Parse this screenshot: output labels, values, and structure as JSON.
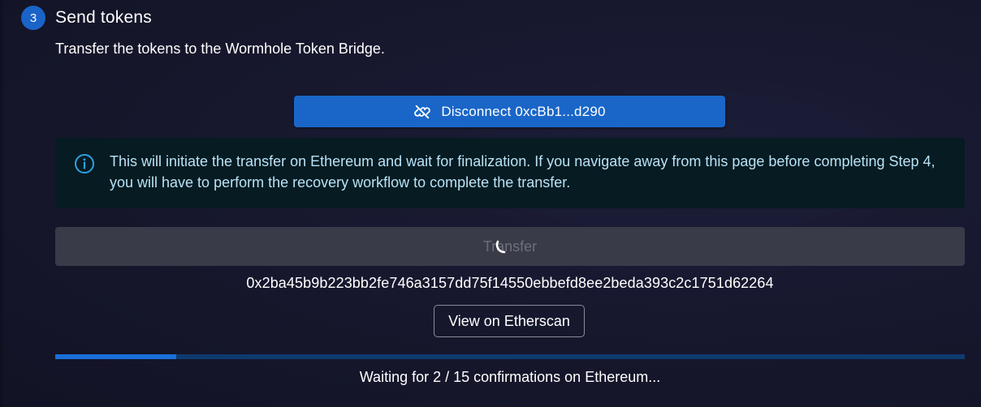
{
  "step": {
    "number": "3",
    "title": "Send tokens",
    "description": "Transfer the tokens to the Wormhole Token Bridge."
  },
  "wallet": {
    "disconnect_label": "Disconnect 0xcBb1...d290",
    "icon": "link-off-icon"
  },
  "alert": {
    "icon": "info-icon",
    "text": "This will initiate the transfer on Ethereum and wait for finalization. If you navigate away from this page before completing Step 4, you will have to perform the recovery workflow to complete the transfer."
  },
  "transfer": {
    "label": "Transfer",
    "loading": true
  },
  "transaction": {
    "hash": "0x2ba45b9b223bb2fe746a3157dd75f14550ebbefd8ee2beda393c2c1751d62264",
    "explorer_label": "View on Etherscan"
  },
  "progress": {
    "confirmations_done": 2,
    "confirmations_required": 15,
    "status_text": "Waiting for 2 / 15 confirmations on Ethereum..."
  },
  "colors": {
    "accent": "#1a66c8",
    "alert_bg": "#071b22",
    "alert_text": "#b8e2f6",
    "progress_fill": "#1a6fd8",
    "progress_track": "#0f3a6e"
  }
}
